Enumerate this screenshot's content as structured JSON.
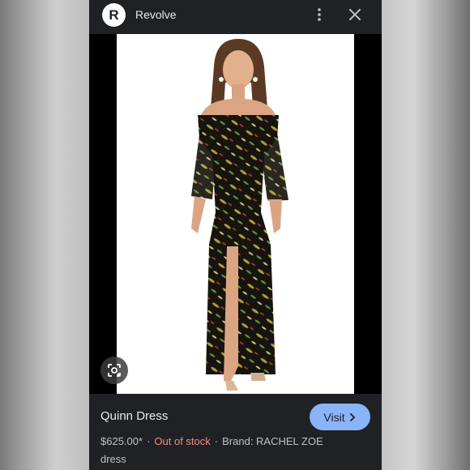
{
  "app": {
    "logo_letter": "R",
    "site_name": "Revolve"
  },
  "icons": {
    "menu": "more-vert-icon",
    "close": "close-icon",
    "lens": "google-lens-icon",
    "chevron": "chevron-right-icon"
  },
  "product": {
    "title": "Quinn Dress",
    "price": "$625.00*",
    "separator": "·",
    "stock_status": "Out of stock",
    "brand": "Brand: RACHEL ZOE",
    "category": "dress"
  },
  "visit_button": {
    "label": "Visit"
  },
  "colors": {
    "panel_bg": "#202124",
    "accent": "#8ab4f8",
    "out_of_stock": "#f28b82",
    "text": "#e8eaed"
  }
}
